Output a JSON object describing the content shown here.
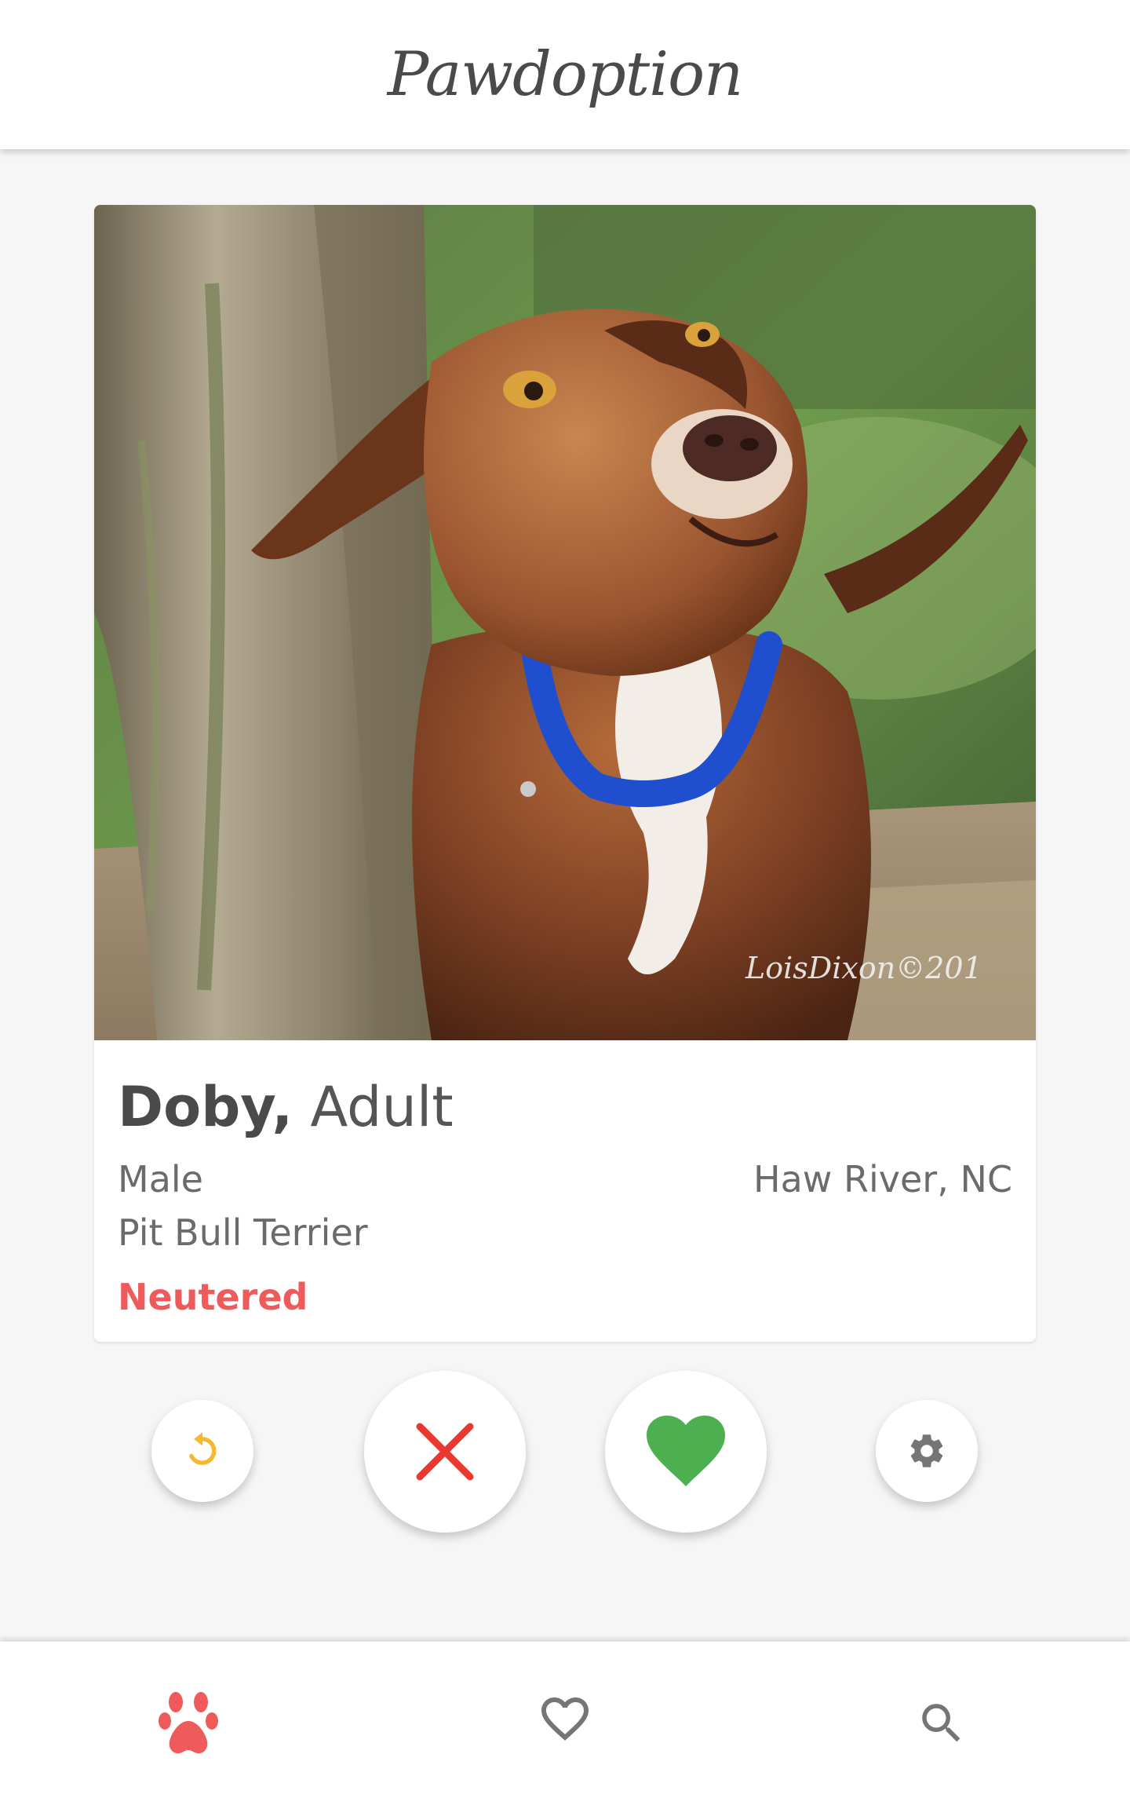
{
  "app": {
    "title": "Pawdoption"
  },
  "pet": {
    "name": "Doby",
    "name_separator": ",",
    "age": "Adult",
    "gender": "Male",
    "breed": "Pit Bull Terrier",
    "location": "Haw River, NC",
    "status": "Neutered",
    "photo_watermark": "LoisDixon©201"
  },
  "actions": [
    {
      "name": "undo",
      "icon": "undo-icon",
      "color": "#f5b82e"
    },
    {
      "name": "dislike",
      "icon": "close-icon",
      "color": "#e8382f"
    },
    {
      "name": "like",
      "icon": "heart-icon",
      "color": "#4caf50"
    },
    {
      "name": "settings",
      "icon": "gear-icon",
      "color": "#757575"
    }
  ],
  "bottom_nav": [
    {
      "name": "discover",
      "icon": "paw-icon",
      "active": true,
      "color": "#ef5b5b"
    },
    {
      "name": "favorites",
      "icon": "heart-outline-icon",
      "active": false,
      "color": "#757575"
    },
    {
      "name": "search",
      "icon": "search-icon",
      "active": false,
      "color": "#757575"
    }
  ],
  "colors": {
    "background": "#f6f6f6",
    "accent": "#ef5b5b",
    "text": "#4a4a4a"
  }
}
